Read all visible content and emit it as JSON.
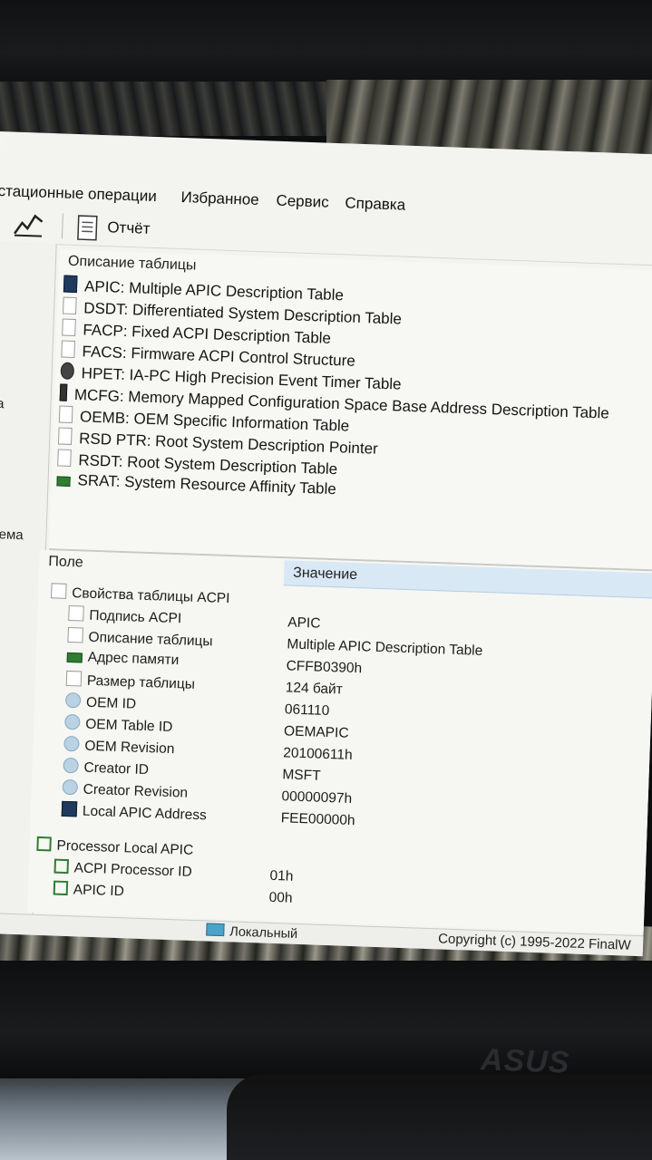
{
  "menu": {
    "items": [
      "стационные операции",
      "Избранное",
      "Сервис",
      "Справка"
    ]
  },
  "toolbar": {
    "report_label": "Отчёт",
    "icons": [
      "chart-icon",
      "report-icon"
    ]
  },
  "left_pane": {
    "fragments": [
      "та",
      "стема"
    ]
  },
  "table_list": {
    "header": "Описание таблицы",
    "items": [
      {
        "label": "APIC: Multiple APIC Description Table",
        "icon": "chip-icon"
      },
      {
        "label": "DSDT: Differentiated System Description Table",
        "icon": "page-icon"
      },
      {
        "label": "FACP: Fixed ACPI Description Table",
        "icon": "page-icon"
      },
      {
        "label": "FACS: Firmware ACPI Control Structure",
        "icon": "page-icon"
      },
      {
        "label": "HPET: IA-PC High Precision Event Timer Table",
        "icon": "clock-icon"
      },
      {
        "label": "MCFG: Memory Mapped Configuration Space Base Address Description Table",
        "icon": "memory-icon"
      },
      {
        "label": "OEMB: OEM Specific Information Table",
        "icon": "page-icon"
      },
      {
        "label": "RSD PTR: Root System Description Pointer",
        "icon": "page-icon"
      },
      {
        "label": "RSDT: Root System Description Table",
        "icon": "page-icon"
      },
      {
        "label": "SRAT: System Resource Affinity Table",
        "icon": "ram-icon"
      }
    ]
  },
  "properties": {
    "col_field": "Поле",
    "col_value": "Значение",
    "group1": "Свойства таблицы ACPI",
    "rows": [
      {
        "field": "Подпись ACPI",
        "value": "APIC",
        "icon": "page-icon"
      },
      {
        "field": "Описание таблицы",
        "value": "Multiple APIC Description Table",
        "icon": "page-icon"
      },
      {
        "field": "Адрес памяти",
        "value": "CFFB0390h",
        "icon": "ram-icon"
      },
      {
        "field": "Размер таблицы",
        "value": "124 байт",
        "icon": "page-icon"
      },
      {
        "field": "OEM ID",
        "value": "061110",
        "icon": "gear-icon"
      },
      {
        "field": "OEM Table ID",
        "value": "OEMAPIC",
        "icon": "gear-icon"
      },
      {
        "field": "OEM Revision",
        "value": "20100611h",
        "icon": "gear-icon"
      },
      {
        "field": "Creator ID",
        "value": "MSFT",
        "icon": "gear-icon"
      },
      {
        "field": "Creator Revision",
        "value": "00000097h",
        "icon": "gear-icon"
      },
      {
        "field": "Local APIC Address",
        "value": "FEE00000h",
        "icon": "chip-icon"
      }
    ],
    "group2": "Processor Local APIC",
    "rows2": [
      {
        "field": "ACPI Processor ID",
        "value": "01h",
        "icon": "green-box-icon"
      },
      {
        "field": "APIC ID",
        "value": "00h",
        "icon": "green-box-icon"
      }
    ]
  },
  "statusbar": {
    "local": "Локальный",
    "copyright": "Copyright (c) 1995-2022 FinalW"
  },
  "branding": {
    "monitor": "ASUS"
  },
  "colors": {
    "value_header_bg": "#d9e8f5",
    "window_bg": "#f3f4ef",
    "green_icon": "#2e7d32"
  }
}
